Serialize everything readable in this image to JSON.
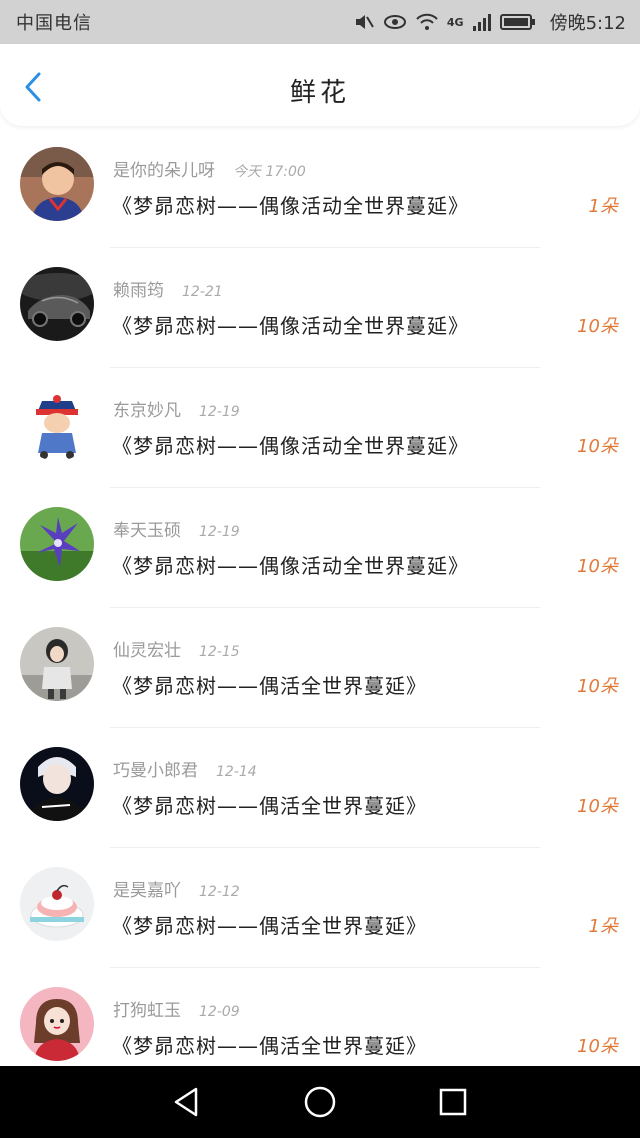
{
  "status_bar": {
    "carrier": "中国电信",
    "network": "4G",
    "time_label": "傍晚5:12",
    "icons": [
      "mute-icon",
      "eye-icon",
      "wifi-icon",
      "signal-icon",
      "battery-icon"
    ]
  },
  "header": {
    "title": "鲜花",
    "back_icon": "chevron-left-icon"
  },
  "colors": {
    "accent_blue": "#2b8fe6",
    "quantity_orange": "#e07a3a",
    "status_bar_bg": "#d2d2d2"
  },
  "items": [
    {
      "name": "是你的朵儿呀",
      "date": "今天 17:00",
      "gift": "《梦昴恋树——偶像活动全世界蔓延》",
      "qty": "1朵"
    },
    {
      "name": "赖雨筠",
      "date": "12-21",
      "gift": "《梦昴恋树——偶像活动全世界蔓延》",
      "qty": "10朵"
    },
    {
      "name": "东京妙凡",
      "date": "12-19",
      "gift": "《梦昴恋树——偶像活动全世界蔓延》",
      "qty": "10朵"
    },
    {
      "name": "奉天玉硕",
      "date": "12-19",
      "gift": "《梦昴恋树——偶像活动全世界蔓延》",
      "qty": "10朵"
    },
    {
      "name": "仙灵宏壮",
      "date": "12-15",
      "gift": "《梦昴恋树——偶活全世界蔓延》",
      "qty": "10朵"
    },
    {
      "name": "巧曼小郎君",
      "date": "12-14",
      "gift": "《梦昴恋树——偶活全世界蔓延》",
      "qty": "10朵"
    },
    {
      "name": "是昊嘉吖",
      "date": "12-12",
      "gift": "《梦昴恋树——偶活全世界蔓延》",
      "qty": "1朵"
    },
    {
      "name": "打狗虹玉",
      "date": "12-09",
      "gift": "《梦昴恋树——偶活全世界蔓延》",
      "qty": "10朵"
    }
  ],
  "nav_bar": {
    "icons": [
      "back-triangle-icon",
      "home-circle-icon",
      "recents-square-icon"
    ]
  }
}
